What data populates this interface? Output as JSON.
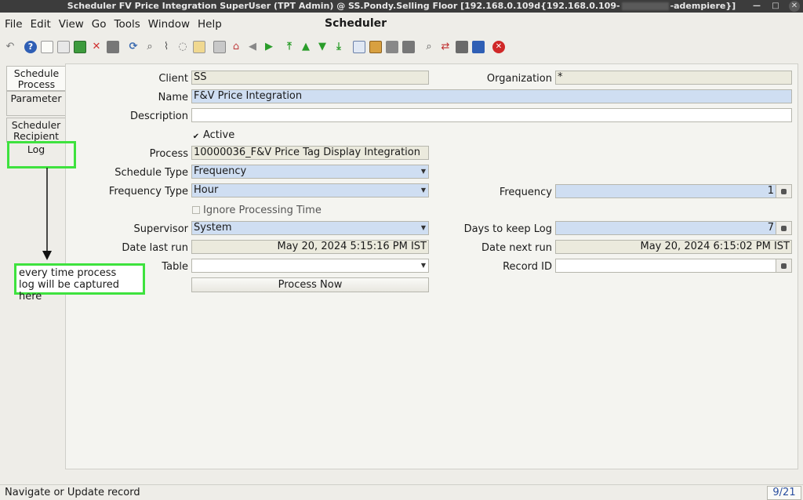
{
  "titlebar": {
    "title_left": "Scheduler  FV Price Integration  SuperUser (TPT Admin) @ SS.Pondy.Selling Floor [192.168.0.109d{192.168.0.109-",
    "title_right": "-adempiere}]"
  },
  "menu": {
    "items": [
      "File",
      "Edit",
      "View",
      "Go",
      "Tools",
      "Window",
      "Help"
    ],
    "window_title": "Scheduler"
  },
  "toolbar": {
    "icons": [
      "undo-icon",
      "help-icon",
      "new-record-icon",
      "copy-record-icon",
      "save-icon",
      "delete-icon",
      "delete-selection-icon",
      "refresh-icon",
      "find-icon",
      "attachment-icon",
      "chat-icon",
      "grid-toggle-icon",
      "history-icon",
      "home-icon",
      "parent-record-icon",
      "detail-record-icon",
      "first-record-icon",
      "previous-record-icon",
      "next-record-icon",
      "last-record-icon",
      "report-icon",
      "archive-icon",
      "print-preview-icon",
      "print-icon",
      "zoom-across-icon",
      "workflow-icon",
      "request-icon",
      "product-info-icon",
      "exit-icon"
    ]
  },
  "tabs": [
    {
      "label": "Schedule Process"
    },
    {
      "label": "Parameter"
    },
    {
      "label": "Scheduler Recipient"
    },
    {
      "label": "Log"
    }
  ],
  "form": {
    "client": {
      "label": "Client",
      "value": "SS"
    },
    "organization": {
      "label": "Organization",
      "value": "*"
    },
    "name": {
      "label": "Name",
      "value": "F&V Price Integration"
    },
    "description": {
      "label": "Description",
      "value": ""
    },
    "active": {
      "label": "Active",
      "checked": true
    },
    "process": {
      "label": "Process",
      "value": "10000036_F&V Price Tag Display Integration"
    },
    "schedule_type": {
      "label": "Schedule Type",
      "value": "Frequency"
    },
    "frequency_type": {
      "label": "Frequency Type",
      "value": "Hour"
    },
    "frequency": {
      "label": "Frequency",
      "value": "1"
    },
    "ignore_processing_time": {
      "label": "Ignore Processing Time",
      "checked": false
    },
    "supervisor": {
      "label": "Supervisor",
      "value": "System"
    },
    "days_to_keep_log": {
      "label": "Days to keep Log",
      "value": "7"
    },
    "date_last_run": {
      "label": "Date last run",
      "value": "May 20, 2024 5:15:16 PM IST"
    },
    "date_next_run": {
      "label": "Date next run",
      "value": "May 20, 2024 6:15:02 PM IST"
    },
    "table": {
      "label": "Table",
      "value": ""
    },
    "record_id": {
      "label": "Record ID",
      "value": ""
    },
    "process_now_label": "Process Now"
  },
  "annotation": {
    "line1": "every time process",
    "line2": "log will be captured here"
  },
  "status": {
    "message": "Navigate or Update record",
    "record_count": "9/21"
  },
  "colors": {
    "mandatory_field": "#cfdef2",
    "readonly_field": "#ebeadd",
    "annotation_green": "#3ee23e",
    "titlebar": "#3c3c3c"
  }
}
